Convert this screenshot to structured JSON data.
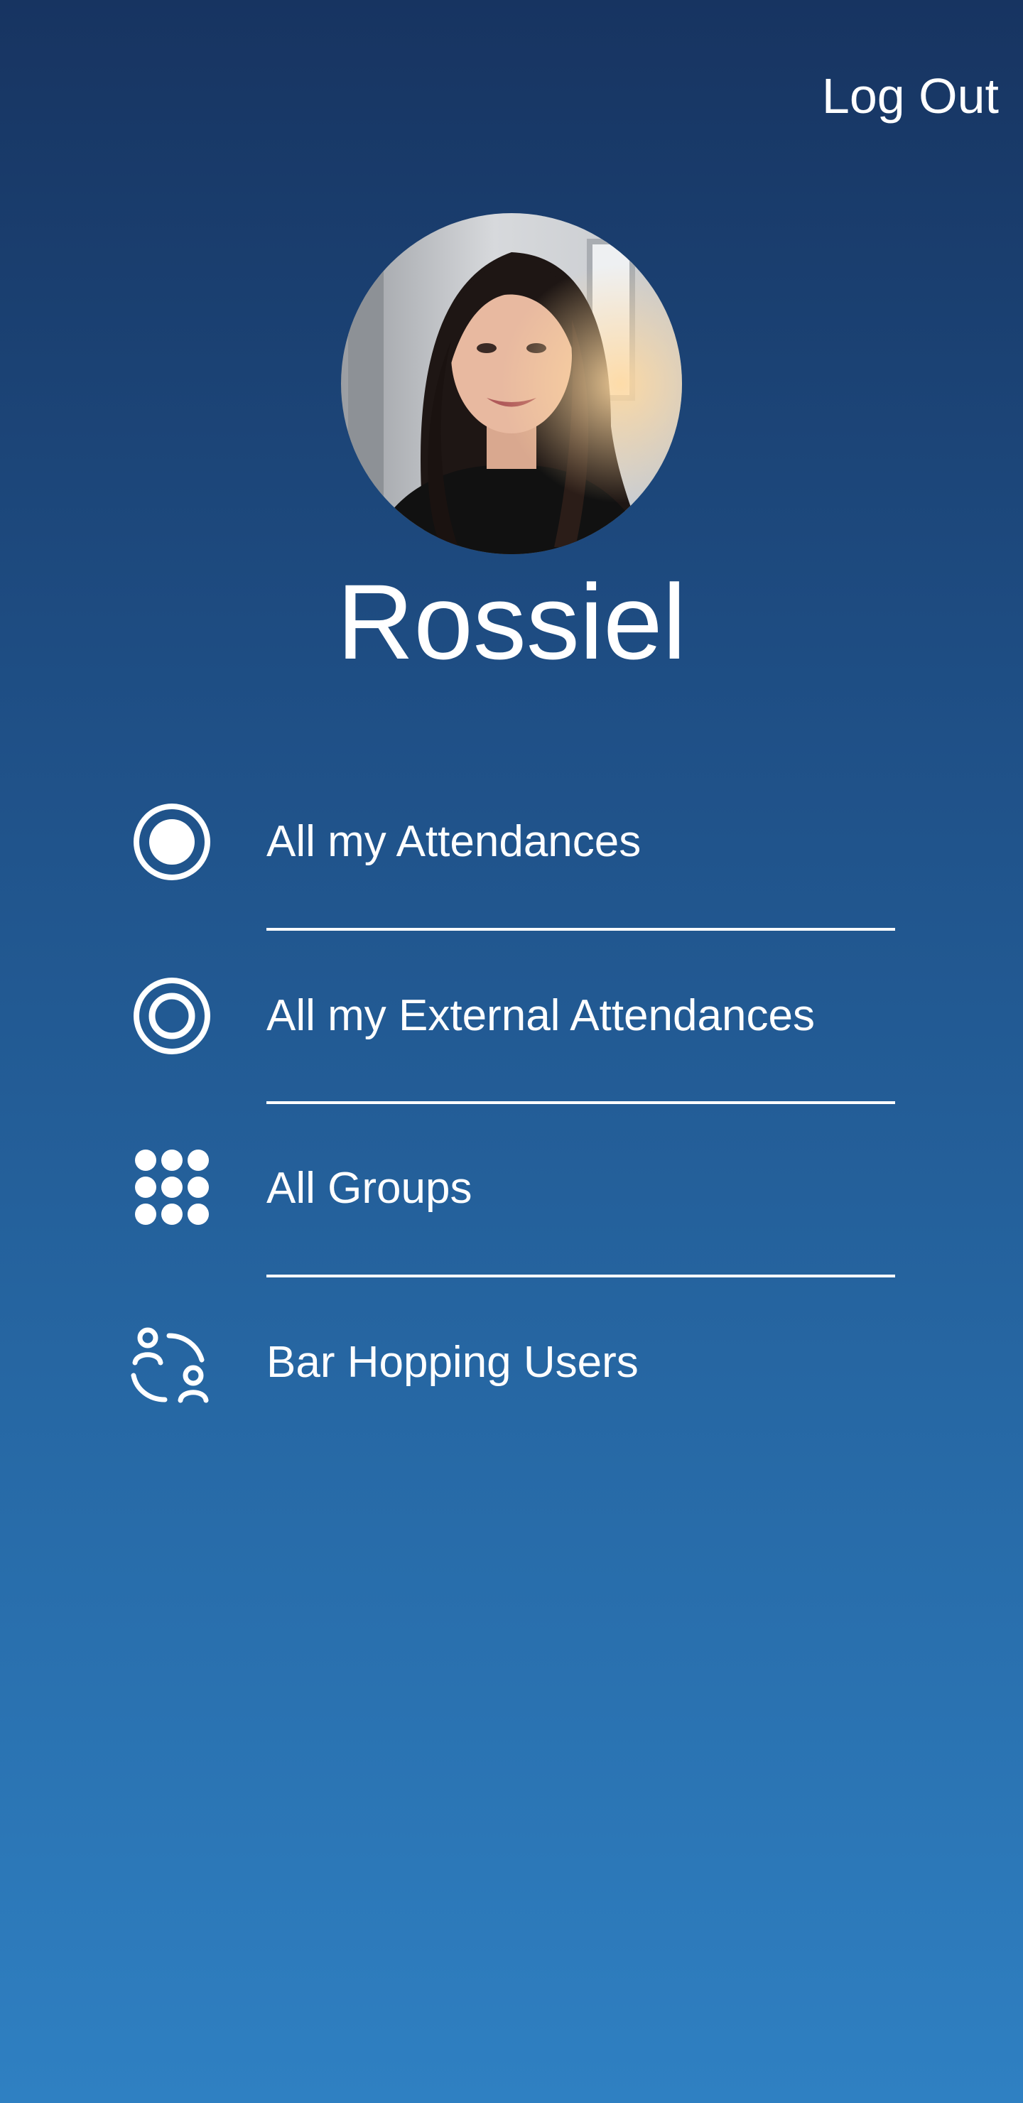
{
  "header": {
    "logout_label": "Log Out"
  },
  "profile": {
    "name": "Rossiel",
    "avatar": "profile-photo"
  },
  "menu": {
    "items": [
      {
        "label": "All my Attendances",
        "icon": "filled-circle-icon"
      },
      {
        "label": "All my External Attendances",
        "icon": "target-circle-icon"
      },
      {
        "label": "All Groups",
        "icon": "dot-grid-icon"
      },
      {
        "label": "Bar Hopping Users",
        "icon": "user-switch-icon"
      }
    ]
  },
  "colors": {
    "gradient_top": "#173461",
    "gradient_bottom": "#2f80c2",
    "text": "#ffffff"
  }
}
